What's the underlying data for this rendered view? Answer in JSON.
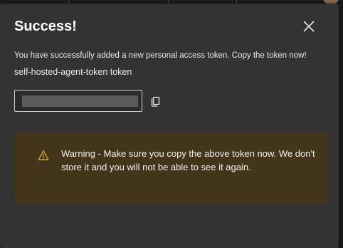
{
  "dialog": {
    "title": "Success!",
    "message": "You have successfully added a new personal access token. Copy the token now!",
    "token_name": "self-hosted-agent-token token",
    "token_field": {
      "value_masked": true
    },
    "warning": {
      "text": "Warning - Make sure you copy the above token now. We don't store it and you will not be able to see it again."
    },
    "icons": {
      "close": "close-icon",
      "copy": "copy-icon",
      "warning": "warning-icon"
    }
  },
  "colors": {
    "dialog_background": "#333333",
    "warning_background": "#433519",
    "warning_icon": "#e8b33a",
    "text": "#ffffff"
  }
}
